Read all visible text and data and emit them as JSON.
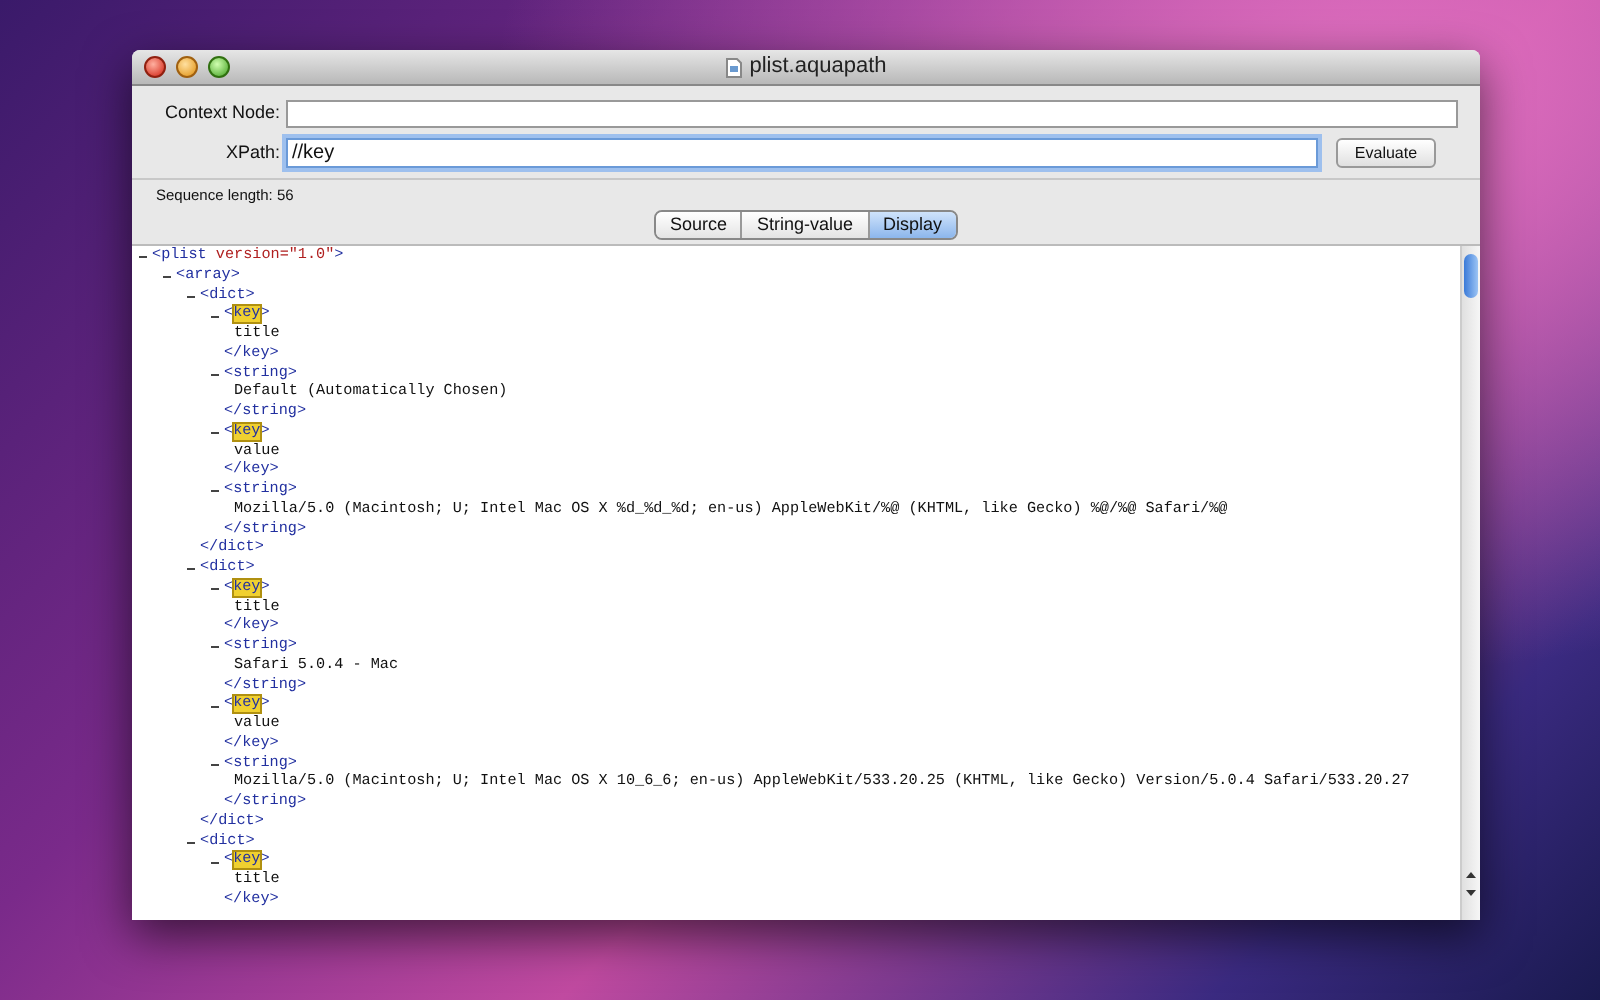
{
  "window": {
    "title": "plist.aquapath"
  },
  "form": {
    "context_node": {
      "label": "Context Node:"
    },
    "xpath": {
      "label": "XPath:",
      "value": "//key"
    },
    "evaluate_button": "Evaluate"
  },
  "status": "Sequence length: 56",
  "tabs": [
    {
      "label": "Source",
      "selected": false
    },
    {
      "label": "String-value",
      "selected": false
    },
    {
      "label": "Display",
      "selected": true
    }
  ],
  "tree": [
    {
      "kind": "element",
      "start": "<",
      "name": "plist",
      "attribute": "version=\"1.0\"",
      "end": ">",
      "highlighted": false,
      "expanded": true,
      "children": [
        {
          "kind": "element",
          "start": "<",
          "name": "array",
          "end": ">",
          "highlighted": false,
          "expanded": true,
          "children": [
            {
              "kind": "element",
              "start": "<",
              "name": "dict",
              "end": ">",
              "highlighted": false,
              "expanded": true,
              "close": "</dict>",
              "children": [
                {
                  "kind": "element",
                  "start": "<",
                  "name": "key",
                  "end": ">",
                  "highlighted": true,
                  "expanded": true,
                  "close": "</key>",
                  "children": [
                    {
                      "kind": "text",
                      "text": "title"
                    }
                  ]
                },
                {
                  "kind": "element",
                  "start": "<",
                  "name": "string",
                  "end": ">",
                  "highlighted": false,
                  "expanded": true,
                  "close": "</string>",
                  "children": [
                    {
                      "kind": "text",
                      "text": "Default (Automatically Chosen)"
                    }
                  ]
                },
                {
                  "kind": "element",
                  "start": "<",
                  "name": "key",
                  "end": ">",
                  "highlighted": true,
                  "expanded": true,
                  "close": "</key>",
                  "children": [
                    {
                      "kind": "text",
                      "text": "value"
                    }
                  ]
                },
                {
                  "kind": "element",
                  "start": "<",
                  "name": "string",
                  "end": ">",
                  "highlighted": false,
                  "expanded": true,
                  "close": "</string>",
                  "children": [
                    {
                      "kind": "text",
                      "text": "Mozilla/5.0 (Macintosh; U; Intel Mac OS X %d_%d_%d; en-us) AppleWebKit/%@ (KHTML, like Gecko) %@/%@ Safari/%@"
                    }
                  ]
                }
              ]
            },
            {
              "kind": "element",
              "start": "<",
              "name": "dict",
              "end": ">",
              "highlighted": false,
              "expanded": true,
              "close": "</dict>",
              "children": [
                {
                  "kind": "element",
                  "start": "<",
                  "name": "key",
                  "end": ">",
                  "highlighted": true,
                  "expanded": true,
                  "close": "</key>",
                  "children": [
                    {
                      "kind": "text",
                      "text": "title"
                    }
                  ]
                },
                {
                  "kind": "element",
                  "start": "<",
                  "name": "string",
                  "end": ">",
                  "highlighted": false,
                  "expanded": true,
                  "close": "</string>",
                  "children": [
                    {
                      "kind": "text",
                      "text": "Safari 5.0.4 - Mac"
                    }
                  ]
                },
                {
                  "kind": "element",
                  "start": "<",
                  "name": "key",
                  "end": ">",
                  "highlighted": true,
                  "expanded": true,
                  "close": "</key>",
                  "children": [
                    {
                      "kind": "text",
                      "text": "value"
                    }
                  ]
                },
                {
                  "kind": "element",
                  "start": "<",
                  "name": "string",
                  "end": ">",
                  "highlighted": false,
                  "expanded": true,
                  "close": "</string>",
                  "children": [
                    {
                      "kind": "text",
                      "text": "Mozilla/5.0 (Macintosh; U; Intel Mac OS X 10_6_6; en-us) AppleWebKit/533.20.25 (KHTML, like Gecko) Version/5.0.4 Safari/533.20.27"
                    }
                  ]
                }
              ]
            },
            {
              "kind": "element",
              "start": "<",
              "name": "dict",
              "end": ">",
              "highlighted": false,
              "expanded": true,
              "children": [
                {
                  "kind": "element",
                  "start": "<",
                  "name": "key",
                  "end": ">",
                  "highlighted": true,
                  "expanded": true,
                  "close": "</key>",
                  "children": [
                    {
                      "kind": "text",
                      "text": "title"
                    }
                  ]
                }
              ]
            }
          ]
        }
      ]
    }
  ]
}
